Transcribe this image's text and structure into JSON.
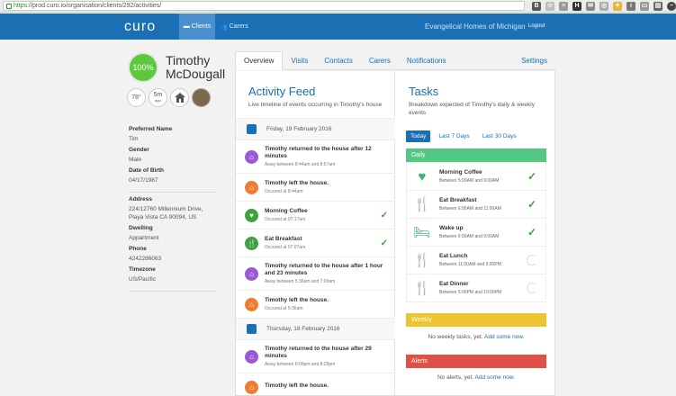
{
  "browser": {
    "url_scheme": "https:",
    "url_rest": "//prod.curo.io/organisation/clients/292/activities/"
  },
  "nav": {
    "logo": "curo",
    "clients_label": "Clients",
    "carers_label": "Carers",
    "org_name": "Evangelical Homes of Michigan",
    "logout_label": "Logout"
  },
  "profile": {
    "score": "100%",
    "name": "Timothy McDougall",
    "temperature": "78°",
    "time_badge": "5m",
    "time_badge_sub": "ago",
    "preferred_name_label": "Preferred Name",
    "preferred_name": "Tim",
    "gender_label": "Gender",
    "gender": "Male",
    "dob_label": "Date of Birth",
    "dob": "04/17/1987",
    "address_label": "Address",
    "address": "224/12760 Millennium Drive, Playa Vista CA 90094, US",
    "dwelling_label": "Dwelling",
    "dwelling": "Appartment",
    "phone_label": "Phone",
    "phone": "4242286063",
    "timezone_label": "Timezone",
    "timezone": "US/Pacific"
  },
  "tabs": [
    "Overview",
    "Visits",
    "Contacts",
    "Carers",
    "Notifications",
    "Settings"
  ],
  "feed": {
    "title": "Activity Feed",
    "subtitle": "Live timeline of events occurring in Timothy's house",
    "items": [
      {
        "kind": "date",
        "text": "Friday, 19 February 2016"
      },
      {
        "kind": "event",
        "icon": "house-return-icon",
        "color": "#9b59d6",
        "headline": "Timothy returned to the house after 12 minutes",
        "meta": "Away between 8:44am and 8:57am",
        "check": false
      },
      {
        "kind": "event",
        "icon": "house-leave-icon",
        "color": "#f07c30",
        "headline": "Timothy left the house.",
        "meta": "Occured at 8:44am",
        "check": false
      },
      {
        "kind": "event",
        "icon": "heart-icon",
        "color": "#3da13d",
        "headline": "Morning Coffee",
        "meta": "Occured at 07:17am",
        "check": true
      },
      {
        "kind": "event",
        "icon": "cutlery-icon",
        "color": "#3da13d",
        "headline": "Eat Breakfast",
        "meta": "Occured at 07:07am",
        "check": true
      },
      {
        "kind": "event",
        "icon": "house-return-icon",
        "color": "#9b59d6",
        "headline": "Timothy returned to the house after 1 hour and 23 minutes",
        "meta": "Away between 5:36am and 7:00am",
        "check": false
      },
      {
        "kind": "event",
        "icon": "house-leave-icon",
        "color": "#f07c30",
        "headline": "Timothy left the house.",
        "meta": "Occured at 5:36am",
        "check": false
      },
      {
        "kind": "date",
        "text": "Thursday, 18 February 2016"
      },
      {
        "kind": "event",
        "icon": "house-return-icon",
        "color": "#9b59d6",
        "headline": "Timothy returned to the house after 29 minutes",
        "meta": "Away between 8:00pm and 8:29pm",
        "check": false
      },
      {
        "kind": "event",
        "icon": "house-leave-icon",
        "color": "#f07c30",
        "headline": "Timothy left the house.",
        "meta": "",
        "check": false
      }
    ]
  },
  "tasks": {
    "title": "Tasks",
    "subtitle": "Breakdown expected of Timothy's daily & weekly events",
    "tabs": [
      "Today",
      "Last 7 Days",
      "Last 30 Days"
    ],
    "daily_label": "Daily",
    "weekly_label": "Weekly",
    "alerts_label": "Alerts",
    "daily": [
      {
        "name": "Morning Coffee",
        "time": "Between 5:00AM and 9:00AM",
        "icon": "heart-icon",
        "done": true
      },
      {
        "name": "Eat Breakfast",
        "time": "Between 6:00AM and 11:00AM",
        "icon": "cutlery-icon",
        "done": true
      },
      {
        "name": "Wake up",
        "time": "Between 6:00AM and 9:00AM",
        "icon": "bed-icon",
        "done": true
      },
      {
        "name": "Eat Lunch",
        "time": "Between 11:00AM and 3:00PM",
        "icon": "cutlery-icon",
        "done": false
      },
      {
        "name": "Eat Dinner",
        "time": "Between 5:00PM and 10:00PM",
        "icon": "cutlery-icon",
        "done": false
      }
    ],
    "weekly_empty": "No weekly tasks, yet.",
    "weekly_link": "Add some now.",
    "alerts_empty": "No alerts, yet.",
    "alerts_link": "Add some now."
  }
}
